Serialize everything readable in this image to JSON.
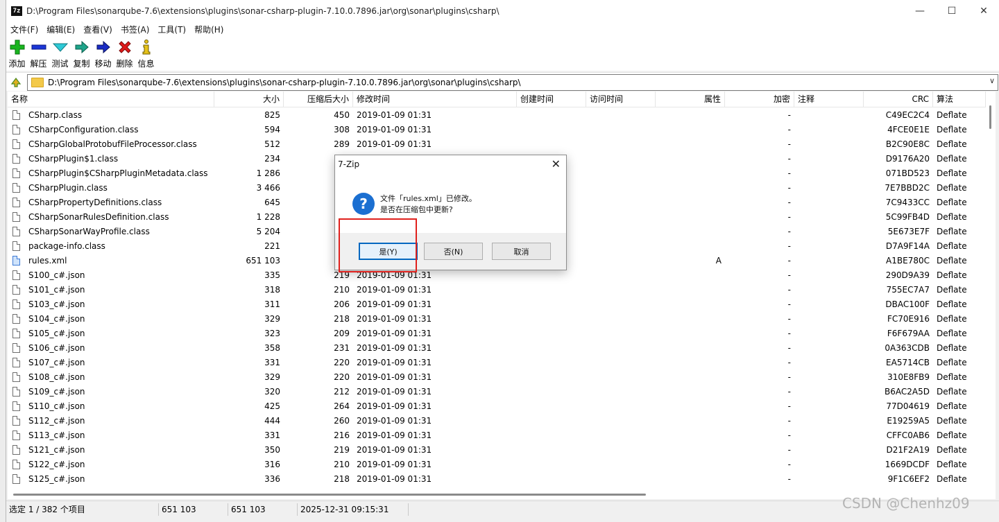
{
  "window": {
    "app_icon": "7z",
    "title": "D:\\Program Files\\sonarqube-7.6\\extensions\\plugins\\sonar-csharp-plugin-7.10.0.7896.jar\\org\\sonar\\plugins\\csharp\\",
    "minimize": "—",
    "maximize": "☐",
    "close": "✕"
  },
  "menu": [
    "文件(F)",
    "编辑(E)",
    "查看(V)",
    "书签(A)",
    "工具(T)",
    "帮助(H)"
  ],
  "toolbar": {
    "add": "添加",
    "extract": "解压",
    "test": "测试",
    "copy": "复制",
    "move": "移动",
    "delete": "删除",
    "info": "信息"
  },
  "address": {
    "path": "D:\\Program Files\\sonarqube-7.6\\extensions\\plugins\\sonar-csharp-plugin-7.10.0.7896.jar\\org\\sonar\\plugins\\csharp\\",
    "dropdown": "∨"
  },
  "columns": {
    "name": "名称",
    "size": "大小",
    "packed": "压缩后大小",
    "modified": "修改时间",
    "created": "创建时间",
    "accessed": "访问时间",
    "attributes": "属性",
    "encrypted": "加密",
    "comment": "注释",
    "crc": "CRC",
    "method": "算法"
  },
  "rows": [
    {
      "name": "CSharp.class",
      "size": "825",
      "packed": "450",
      "modified": "2019-01-09 01:31",
      "attr": "",
      "enc": "-",
      "crc": "C49EC2C4",
      "method": "Deflate"
    },
    {
      "name": "CSharpConfiguration.class",
      "size": "594",
      "packed": "308",
      "modified": "2019-01-09 01:31",
      "attr": "",
      "enc": "-",
      "crc": "4FCE0E1E",
      "method": "Deflate"
    },
    {
      "name": "CSharpGlobalProtobufFileProcessor.class",
      "size": "512",
      "packed": "289",
      "modified": "2019-01-09 01:31",
      "attr": "",
      "enc": "-",
      "crc": "B2C90E8C",
      "method": "Deflate"
    },
    {
      "name": "CSharpPlugin$1.class",
      "size": "234",
      "packed": "",
      "modified": "",
      "attr": "",
      "enc": "-",
      "crc": "D9176A20",
      "method": "Deflate"
    },
    {
      "name": "CSharpPlugin$CSharpPluginMetadata.class",
      "size": "1 286",
      "packed": "",
      "modified": "",
      "attr": "",
      "enc": "-",
      "crc": "071BD523",
      "method": "Deflate"
    },
    {
      "name": "CSharpPlugin.class",
      "size": "3 466",
      "packed": "1",
      "modified": "",
      "attr": "",
      "enc": "-",
      "crc": "7E7BBD2C",
      "method": "Deflate"
    },
    {
      "name": "CSharpPropertyDefinitions.class",
      "size": "645",
      "packed": "",
      "modified": "",
      "attr": "",
      "enc": "-",
      "crc": "7C9433CC",
      "method": "Deflate"
    },
    {
      "name": "CSharpSonarRulesDefinition.class",
      "size": "1 228",
      "packed": "",
      "modified": "",
      "attr": "",
      "enc": "-",
      "crc": "5C99FB4D",
      "method": "Deflate"
    },
    {
      "name": "CSharpSonarWayProfile.class",
      "size": "5 204",
      "packed": "2",
      "modified": "",
      "attr": "",
      "enc": "-",
      "crc": "5E673E7F",
      "method": "Deflate"
    },
    {
      "name": "package-info.class",
      "size": "221",
      "packed": "",
      "modified": "",
      "attr": "",
      "enc": "-",
      "crc": "D7A9F14A",
      "method": "Deflate"
    },
    {
      "name": "rules.xml",
      "size": "651 103",
      "packed": "132",
      "modified": "",
      "attr": "A",
      "enc": "-",
      "crc": "A1BE780C",
      "method": "Deflate",
      "xml": true
    },
    {
      "name": "S100_c#.json",
      "size": "335",
      "packed": "219",
      "modified": "2019-01-09 01:31",
      "attr": "",
      "enc": "-",
      "crc": "290D9A39",
      "method": "Deflate"
    },
    {
      "name": "S101_c#.json",
      "size": "318",
      "packed": "210",
      "modified": "2019-01-09 01:31",
      "attr": "",
      "enc": "-",
      "crc": "755EC7A7",
      "method": "Deflate"
    },
    {
      "name": "S103_c#.json",
      "size": "311",
      "packed": "206",
      "modified": "2019-01-09 01:31",
      "attr": "",
      "enc": "-",
      "crc": "DBAC100F",
      "method": "Deflate"
    },
    {
      "name": "S104_c#.json",
      "size": "329",
      "packed": "218",
      "modified": "2019-01-09 01:31",
      "attr": "",
      "enc": "-",
      "crc": "FC70E916",
      "method": "Deflate"
    },
    {
      "name": "S105_c#.json",
      "size": "323",
      "packed": "209",
      "modified": "2019-01-09 01:31",
      "attr": "",
      "enc": "-",
      "crc": "F6F679AA",
      "method": "Deflate"
    },
    {
      "name": "S106_c#.json",
      "size": "358",
      "packed": "231",
      "modified": "2019-01-09 01:31",
      "attr": "",
      "enc": "-",
      "crc": "0A363CDB",
      "method": "Deflate"
    },
    {
      "name": "S107_c#.json",
      "size": "331",
      "packed": "220",
      "modified": "2019-01-09 01:31",
      "attr": "",
      "enc": "-",
      "crc": "EA5714CB",
      "method": "Deflate"
    },
    {
      "name": "S108_c#.json",
      "size": "329",
      "packed": "220",
      "modified": "2019-01-09 01:31",
      "attr": "",
      "enc": "-",
      "crc": "310E8FB9",
      "method": "Deflate"
    },
    {
      "name": "S109_c#.json",
      "size": "320",
      "packed": "212",
      "modified": "2019-01-09 01:31",
      "attr": "",
      "enc": "-",
      "crc": "B6AC2A5D",
      "method": "Deflate"
    },
    {
      "name": "S110_c#.json",
      "size": "425",
      "packed": "264",
      "modified": "2019-01-09 01:31",
      "attr": "",
      "enc": "-",
      "crc": "77D04619",
      "method": "Deflate"
    },
    {
      "name": "S112_c#.json",
      "size": "444",
      "packed": "260",
      "modified": "2019-01-09 01:31",
      "attr": "",
      "enc": "-",
      "crc": "E19259A5",
      "method": "Deflate"
    },
    {
      "name": "S113_c#.json",
      "size": "331",
      "packed": "216",
      "modified": "2019-01-09 01:31",
      "attr": "",
      "enc": "-",
      "crc": "CFFC0AB6",
      "method": "Deflate"
    },
    {
      "name": "S121_c#.json",
      "size": "350",
      "packed": "219",
      "modified": "2019-01-09 01:31",
      "attr": "",
      "enc": "-",
      "crc": "D21F2A19",
      "method": "Deflate"
    },
    {
      "name": "S122_c#.json",
      "size": "316",
      "packed": "210",
      "modified": "2019-01-09 01:31",
      "attr": "",
      "enc": "-",
      "crc": "1669DCDF",
      "method": "Deflate"
    },
    {
      "name": "S125_c#.json",
      "size": "336",
      "packed": "218",
      "modified": "2019-01-09 01:31",
      "attr": "",
      "enc": "-",
      "crc": "9F1C6EF2",
      "method": "Deflate"
    }
  ],
  "status": {
    "selection": "选定 1 / 382 个项目",
    "size": "651 103",
    "packed": "651 103",
    "datetime": "2025-12-31 09:15:31"
  },
  "dialog": {
    "title": "7-Zip",
    "close": "✕",
    "icon": "?",
    "message_line1": "文件「rules.xml」已修改。",
    "message_line2": "是否在压缩包中更新?",
    "yes": "是(Y)",
    "no": "否(N)",
    "cancel": "取消"
  },
  "colors": {
    "highlight_box": "#e0201c",
    "dialog_default_border": "#0067c0",
    "question_icon": "#1b6fd1"
  },
  "watermark": "CSDN @Chenhz09"
}
